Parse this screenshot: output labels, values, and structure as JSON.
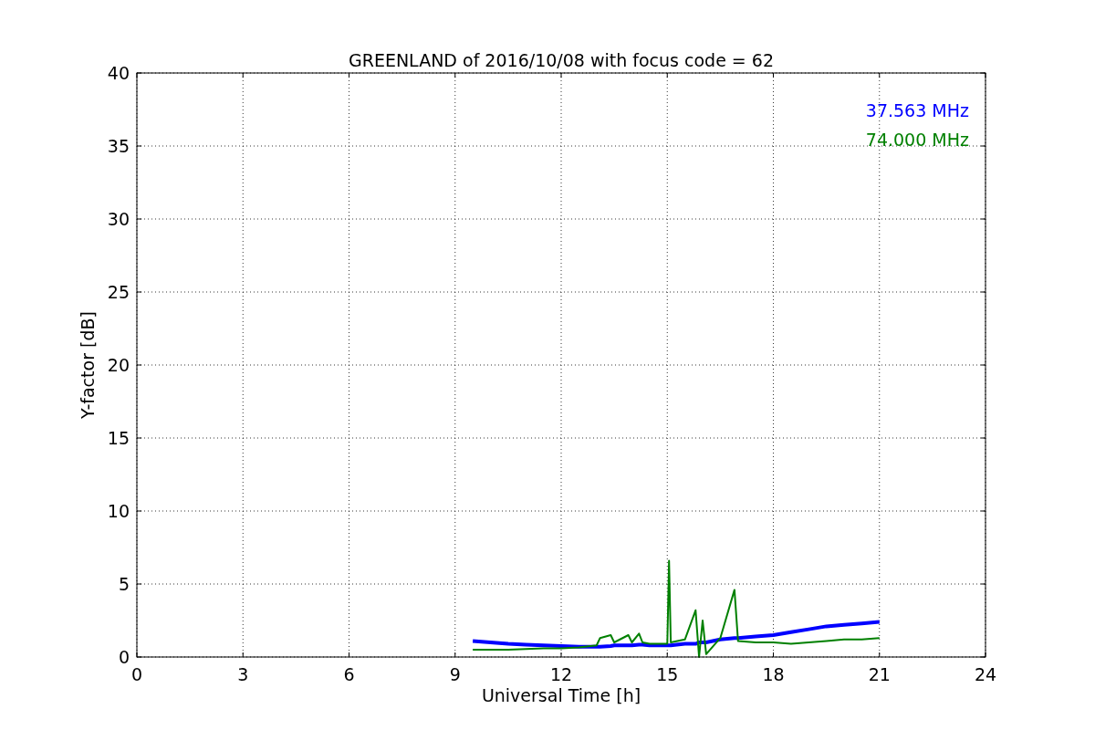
{
  "chart_data": {
    "type": "line",
    "title": "GREENLAND of 2016/10/08 with focus code = 62",
    "xlabel": "Universal Time [h]",
    "ylabel": "Y-factor [dB]",
    "x": [
      9.5,
      10,
      10.5,
      11,
      11.5,
      12,
      12.5,
      13,
      13.1,
      13.4,
      13.5,
      13.9,
      14,
      14.2,
      14.3,
      14.5,
      15,
      15.05,
      15.1,
      15.5,
      15.8,
      15.9,
      16,
      16.1,
      16.5,
      16.9,
      17,
      17.5,
      18,
      18.5,
      19,
      19.5,
      20,
      20.5,
      21
    ],
    "series": [
      {
        "name": "37.563 MHz",
        "color": "#0000ff",
        "values": [
          1.1,
          1.0,
          0.9,
          0.85,
          0.8,
          0.75,
          0.7,
          0.7,
          0.7,
          0.75,
          0.8,
          0.8,
          0.8,
          0.85,
          0.85,
          0.8,
          0.8,
          0.8,
          0.8,
          0.9,
          0.9,
          1.0,
          1.0,
          1.0,
          1.2,
          1.3,
          1.3,
          1.4,
          1.5,
          1.7,
          1.9,
          2.1,
          2.2,
          2.3,
          2.4
        ]
      },
      {
        "name": "74.000 MHz",
        "color": "#008000",
        "values": [
          0.5,
          0.5,
          0.5,
          0.55,
          0.6,
          0.6,
          0.65,
          0.8,
          1.3,
          1.5,
          1.0,
          1.5,
          1.0,
          1.6,
          1.0,
          0.9,
          0.9,
          6.6,
          1.0,
          1.2,
          3.2,
          0.0,
          2.5,
          0.2,
          1.3,
          4.6,
          1.1,
          1.0,
          1.0,
          0.9,
          1.0,
          1.1,
          1.2,
          1.2,
          1.3
        ]
      }
    ],
    "xlim": [
      0,
      24
    ],
    "ylim": [
      0,
      40
    ],
    "xticks": [
      0,
      3,
      6,
      9,
      12,
      15,
      18,
      21,
      24
    ],
    "yticks": [
      0,
      5,
      10,
      15,
      20,
      25,
      30,
      35,
      40
    ],
    "grid": true
  }
}
